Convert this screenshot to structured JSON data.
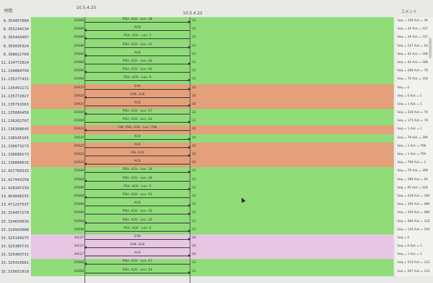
{
  "header": {
    "time_label": "時間",
    "host_a": "10.5.4.23",
    "host_b": "10.5.4.22",
    "comment_label": "コメント"
  },
  "colors": {
    "green": "#8fdc78",
    "orange": "#e3a07a",
    "pink": "#e6c6e3"
  },
  "rows": [
    {
      "t": "8.354957080",
      "pa": "35688",
      "pb": "23",
      "lbl": "PSH, ACK - Len: 38",
      "dir": "r",
      "c": "Seq = 199 Ack = 39",
      "color": "green"
    },
    {
      "t": "8.355244134",
      "pa": "35688",
      "pb": "23",
      "lbl": "ACK",
      "dir": "l",
      "c": "Seq = 39 Ack = 237",
      "color": "green"
    },
    {
      "t": "8.355443407",
      "pa": "35688",
      "pb": "23",
      "lbl": "PSH, ACK - Len: 5",
      "dir": "l",
      "c": "Seq = 39 Ack = 237",
      "color": "green"
    },
    {
      "t": "8.355035324",
      "pa": "35688",
      "pb": "23",
      "lbl": "PSH, ACK - Len: 31",
      "dir": "r",
      "c": "Seq = 237 Ack = 44",
      "color": "green"
    },
    {
      "t": "8.398022760",
      "pa": "35688",
      "pb": "23",
      "lbl": "ACK",
      "dir": "l",
      "c": "Seq = 44 Ack = 268",
      "color": "green"
    },
    {
      "t": "11.134772024",
      "pa": "35688",
      "pb": "23",
      "lbl": "PSH, ACK - Len: 26",
      "dir": "r",
      "c": "Seq = 44 Ack = 268",
      "color": "green"
    },
    {
      "t": "11.134884794",
      "pa": "35688",
      "pb": "23",
      "lbl": "PSH, ACK - Len: 40",
      "dir": "l",
      "c": "Seq = 268 Ack = 70",
      "color": "green"
    },
    {
      "t": "11.135277431",
      "pa": "35688",
      "pb": "23",
      "lbl": "PSH, ACK - Len: 9",
      "dir": "r",
      "c": "Seq = 70 Ack = 318",
      "color": "green"
    },
    {
      "t": "11.135491171",
      "pa": "34920",
      "pb": "20",
      "lbl": "SYN",
      "dir": "r",
      "c": "Seq = 0",
      "color": "orange"
    },
    {
      "t": "11.135772027",
      "pa": "34920",
      "pb": "20",
      "lbl": "SYN, ACK",
      "dir": "l",
      "c": "Seq = 0 Ack = 1",
      "color": "orange"
    },
    {
      "t": "11.135791563",
      "pa": "34920",
      "pb": "20",
      "lbl": "ACK",
      "dir": "r",
      "c": "Seq = 1 Ack = 1",
      "color": "orange"
    },
    {
      "t": "11.135806456",
      "pa": "35688",
      "pb": "23",
      "lbl": "PSH, ACK - Len: 57",
      "dir": "l",
      "c": "Seq = 318 Ack = 79",
      "color": "green"
    },
    {
      "t": "11.136262707",
      "pa": "35688",
      "pb": "23",
      "lbl": "PSH, ACK - Len: 24",
      "dir": "r",
      "c": "Seq = 175 Ack = 79",
      "color": "green"
    },
    {
      "t": "11.136308645",
      "pa": "34920",
      "pb": "20",
      "lbl": "FIN, PSH, ACK - Len: 798",
      "dir": "l",
      "c": "Seq = 1 Ack = 1",
      "color": "orange"
    },
    {
      "t": "11.136545165",
      "pa": "34920",
      "pb": "20",
      "lbl": "ACK",
      "dir": "r",
      "c": "Seq = 79 Ack = 399",
      "color": "green"
    },
    {
      "t": "11.136673273",
      "pa": "34920",
      "pb": "20",
      "lbl": "ACK",
      "dir": "r",
      "c": "Seq = 1 Ack = 798",
      "color": "orange"
    },
    {
      "t": "11.136680173",
      "pa": "34920",
      "pb": "20",
      "lbl": "FIN, ACK",
      "dir": "r",
      "c": "Seq = 1 Ack = 799",
      "color": "orange"
    },
    {
      "t": "11.136890615",
      "pa": "34920",
      "pb": "20",
      "lbl": "ACK",
      "dir": "l",
      "c": "Seq = 799 Ack = 2",
      "color": "orange"
    },
    {
      "t": "12.427760333",
      "pa": "35688",
      "pb": "23",
      "lbl": "PSH, ACK - Len: 16",
      "dir": "r",
      "c": "Seq = 79 Ack = 399",
      "color": "green"
    },
    {
      "t": "12.427943258",
      "pa": "35688",
      "pb": "23",
      "lbl": "PSH, ACK - Len: 29",
      "dir": "l",
      "c": "Seq = 399 Ack = 95",
      "color": "green"
    },
    {
      "t": "12.428347239",
      "pa": "35688",
      "pb": "23",
      "lbl": "PSH, ACK - Len: 5",
      "dir": "r",
      "c": "Seq = 95 Ack = 428",
      "color": "green"
    },
    {
      "t": "13.464840155",
      "pa": "35688",
      "pb": "23",
      "lbl": "PSH, ACK - Len: 52",
      "dir": "l",
      "c": "Seq = 428 Ack = 100",
      "color": "green"
    },
    {
      "t": "13.471237537",
      "pa": "35688",
      "pb": "23",
      "lbl": "ACK",
      "dir": "r",
      "c": "Seq = 100 Ack = 480",
      "color": "green"
    },
    {
      "t": "15.324457278",
      "pa": "35688",
      "pb": "23",
      "lbl": "PSH, ACK - Len: 35",
      "dir": "r",
      "c": "Seq = 100 Ack = 480",
      "color": "green"
    },
    {
      "t": "15.324650939",
      "pa": "35688",
      "pb": "23",
      "lbl": "PSH, ACK - Len: 20",
      "dir": "l",
      "c": "Seq = 480 Ack = 126",
      "color": "green"
    },
    {
      "t": "15.324943088",
      "pa": "35688",
      "pb": "23",
      "lbl": "PSH, ACK - Len: 6",
      "dir": "r",
      "c": "Seq = 126 Ack = 500",
      "color": "green"
    },
    {
      "t": "15.325104275",
      "pa": "34127",
      "pb": "20",
      "lbl": "SYN",
      "dir": "r",
      "c": "Seq = 0",
      "color": "pink"
    },
    {
      "t": "15.325385715",
      "pa": "34127",
      "pb": "20",
      "lbl": "SYN, ACK",
      "dir": "l",
      "c": "Seq = 0 Ack = 1",
      "color": "pink"
    },
    {
      "t": "15.325403731",
      "pa": "34127",
      "pb": "20",
      "lbl": "ACK",
      "dir": "r",
      "c": "Seq = 1 Ack = 1",
      "color": "pink"
    },
    {
      "t": "15.325415661",
      "pa": "35688",
      "pb": "23",
      "lbl": "PSH, ACK - Len: 57",
      "dir": "l",
      "c": "Seq = 510 Ack = 132",
      "color": "green"
    },
    {
      "t": "15.325652910",
      "pa": "35688",
      "pb": "23",
      "lbl": "PSH, ACK - Len: 24",
      "dir": "r",
      "c": "Seq = 567 Ack = 132",
      "color": "green"
    }
  ]
}
